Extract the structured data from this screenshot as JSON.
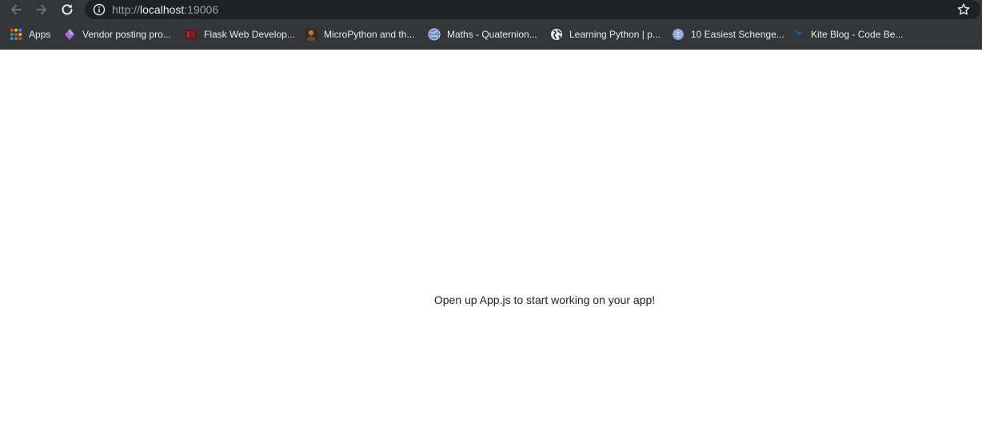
{
  "browser": {
    "url_scheme": "http://",
    "url_host": "localhost",
    "url_port": ":19006",
    "colors": {
      "chrome_bg": "#35363a",
      "omnibox_bg": "#202124",
      "text": "#e8eaed",
      "muted": "#9aa0a6"
    }
  },
  "bookmarks": [
    {
      "label": "Apps",
      "icon": "apps-grid-icon"
    },
    {
      "label": "Vendor posting pro...",
      "icon": "diamond-icon"
    },
    {
      "label": "Flask Web Develop...",
      "icon": "flask-book-icon"
    },
    {
      "label": "MicroPython and th...",
      "icon": "avatar-icon"
    },
    {
      "label": "Maths - Quaternion...",
      "icon": "globe-icon"
    },
    {
      "label": "Learning Python | p...",
      "icon": "globe-icon"
    },
    {
      "label": "10 Easiest Schenge...",
      "icon": "globe-icon"
    },
    {
      "label": "Kite Blog - Code Be...",
      "icon": "kite-icon"
    }
  ],
  "page": {
    "message": "Open up App.js to start working on your app!"
  }
}
